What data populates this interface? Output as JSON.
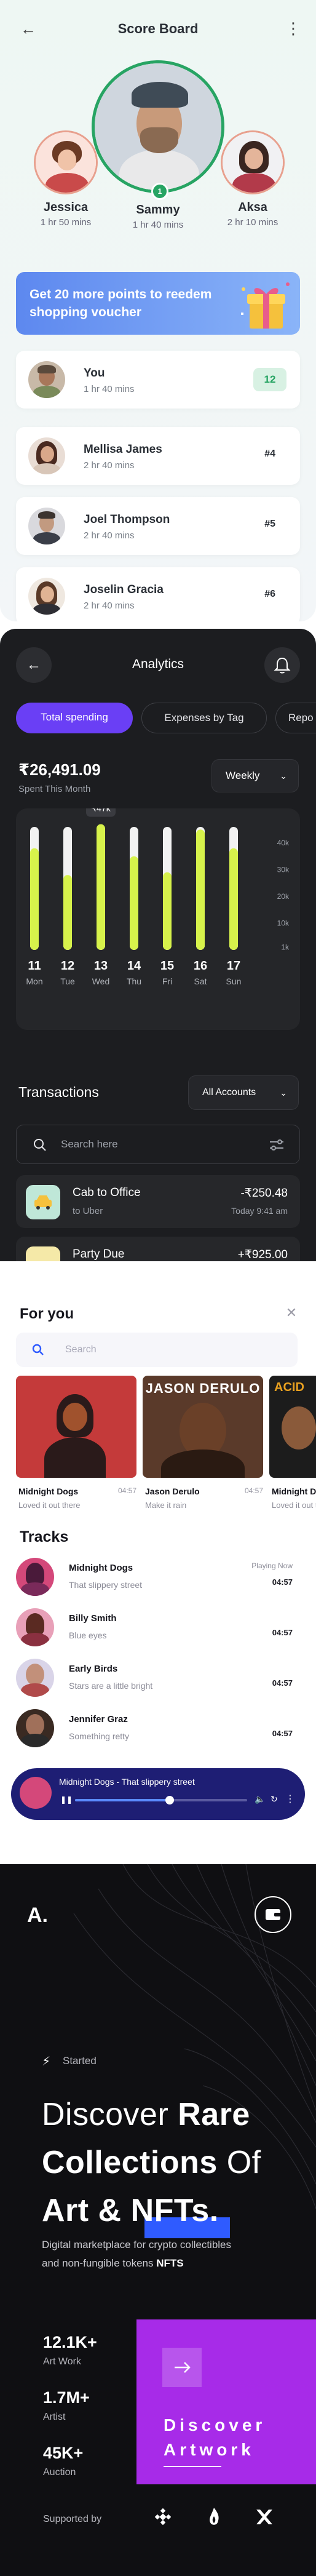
{
  "scoreboard": {
    "title": "Score Board",
    "podium": [
      {
        "name": "Jessica",
        "time": "1 hr 50 mins"
      },
      {
        "name": "Sammy",
        "time": "1 hr 40 mins",
        "rank": "1"
      },
      {
        "name": "Aksa",
        "time": "2 hr 10 mins"
      }
    ],
    "promo": "Get 20 more points to reedem shopping voucher",
    "rows": [
      {
        "name": "You",
        "time": "1 hr 40 mins",
        "rank": "12"
      },
      {
        "name": "Mellisa James",
        "time": "2 hr 40 mins",
        "rank": "#4"
      },
      {
        "name": "Joel Thompson",
        "time": "2 hr 40 mins",
        "rank": "#5"
      },
      {
        "name": "Joselin Gracia",
        "time": "2 hr 40 mins",
        "rank": "#6"
      }
    ],
    "colors": {
      "accent": "#27a463",
      "promo_start": "#5d88ef",
      "promo_end": "#8ab4f8"
    }
  },
  "analytics": {
    "title": "Analytics",
    "tabs": [
      "Total spending",
      "Expenses by Tag",
      "Repo"
    ],
    "amount": "₹26,491.09",
    "amount_label": "Spent This Month",
    "period": "Weekly",
    "tooltip": "₹47k",
    "transactions_title": "Transactions",
    "accounts_select": "All Accounts",
    "search_placeholder": "Search here",
    "transactions": [
      {
        "name": "Cab to Office",
        "sub": "to Uber",
        "amount": "-₹250.48",
        "time": "Today 9:41 am",
        "icon": "car-icon"
      },
      {
        "name": "Party Due",
        "sub": "",
        "amount": "+₹925.00",
        "time": "",
        "icon": "party-icon"
      }
    ],
    "colors": {
      "bar": "#d7f24b",
      "tab_active": "#6a3ff5"
    }
  },
  "chart_data": {
    "type": "bar",
    "categories": [
      "11 Mon",
      "12 Tue",
      "13 Wed",
      "14 Thu",
      "15 Fri",
      "16 Sat",
      "17 Sun"
    ],
    "x": [
      {
        "day": "11",
        "wd": "Mon"
      },
      {
        "day": "12",
        "wd": "Tue"
      },
      {
        "day": "13",
        "wd": "Wed"
      },
      {
        "day": "14",
        "wd": "Thu"
      },
      {
        "day": "15",
        "wd": "Fri"
      },
      {
        "day": "16",
        "wd": "Sat"
      },
      {
        "day": "17",
        "wd": "Sun"
      }
    ],
    "values": [
      38,
      28,
      47,
      35,
      29,
      45,
      38
    ],
    "max": [
      46,
      46,
      46,
      46,
      46,
      46,
      46
    ],
    "yticks": [
      "40k",
      "30k",
      "20k",
      "10k",
      "1k"
    ],
    "ytick_values": [
      40,
      30,
      20,
      10,
      1
    ],
    "ylim": [
      0,
      46
    ],
    "unit": "k",
    "highlight_index": 2
  },
  "music": {
    "for_you_title": "For you",
    "search_placeholder": "Search",
    "albums": [
      {
        "title": "Midnight Dogs",
        "duration": "04:57",
        "sub": "Loved it out there"
      },
      {
        "title": "Jason Derulo",
        "duration": "04:57",
        "sub": "Make it rain",
        "cover_text": "JASON DERULO"
      },
      {
        "title": "Midnight Dogs",
        "duration": "",
        "sub": "Loved it out there",
        "cover_text": "ACID"
      }
    ],
    "tracks_title": "Tracks",
    "tracks": [
      {
        "title": "Midnight Dogs",
        "artist": "That slippery street",
        "now": "Playing Now",
        "duration": "04:57"
      },
      {
        "title": "Billy Smith",
        "artist": "Blue eyes",
        "now": "",
        "duration": "04:57"
      },
      {
        "title": "Early Birds",
        "artist": "Stars are a little bright",
        "now": "",
        "duration": "04:57"
      },
      {
        "title": "Jennifer Graz",
        "artist": "Something retty",
        "now": "",
        "duration": "04:57"
      }
    ],
    "player": {
      "title": "Midnight Dogs - That slippery street",
      "progress": 0.55
    },
    "colors": {
      "player_bg": "#1e1e74",
      "accent": "#2f5bff"
    }
  },
  "nft": {
    "logo": "A.",
    "started": "Started",
    "hero": {
      "l1_light": "Discover ",
      "l1_bold": "Rare",
      "l2_bold": "Collections",
      "l2_light": " Of",
      "l3_bold": "Art & ",
      "l3_hl": "NFTs."
    },
    "desc_1": "Digital marketplace for crypto collectibles",
    "desc_2": "and non-fungible tokens ",
    "desc_bold": "NFTS",
    "stats": [
      {
        "value": "12.1K+",
        "label": "Art Work"
      },
      {
        "value": "1.7M+",
        "label": "Artist"
      },
      {
        "value": "45K+",
        "label": "Auction"
      }
    ],
    "discover_l1": "Discover",
    "discover_l2": "Artwork",
    "supported_by": "Supported by",
    "colors": {
      "purple": "#a72be8",
      "highlight": "#2f5bff"
    }
  }
}
